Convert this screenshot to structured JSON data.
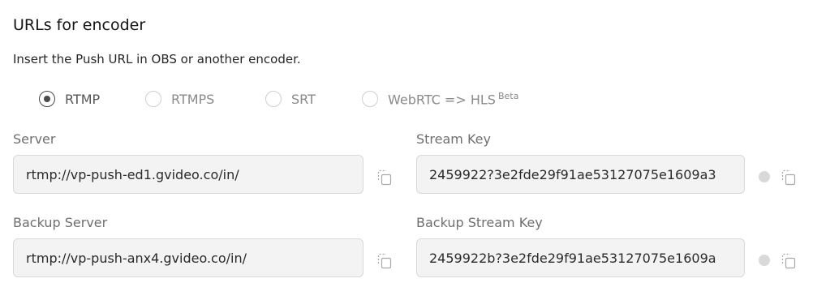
{
  "header": {
    "title": "URLs for encoder",
    "subtitle": "Insert the Push URL in OBS or another encoder."
  },
  "protocols": {
    "selected": "RTMP",
    "options": [
      {
        "label": "RTMP"
      },
      {
        "label": "RTMPS"
      },
      {
        "label": "SRT"
      },
      {
        "label": "WebRTC => HLS",
        "badge": "Beta"
      }
    ]
  },
  "fields": {
    "server": {
      "label": "Server",
      "value": "rtmp://vp-push-ed1.gvideo.co/in/"
    },
    "stream_key": {
      "label": "Stream Key",
      "value": "2459922?3e2fde29f91ae53127075e1609a3"
    },
    "backup_server": {
      "label": "Backup Server",
      "value": "rtmp://vp-push-anx4.gvideo.co/in/"
    },
    "backup_stream_key": {
      "label": "Backup Stream Key",
      "value": "2459922b?3e2fde29f91ae53127075e1609a"
    }
  },
  "icons": {
    "copy": "copy-icon",
    "visibility": "visibility-toggle-icon"
  },
  "colors": {
    "field_bg": "#f3f3f3",
    "field_border": "#d9d9d9",
    "radio_checked": "#4a4a4a",
    "muted_text": "#8a8a8a"
  }
}
